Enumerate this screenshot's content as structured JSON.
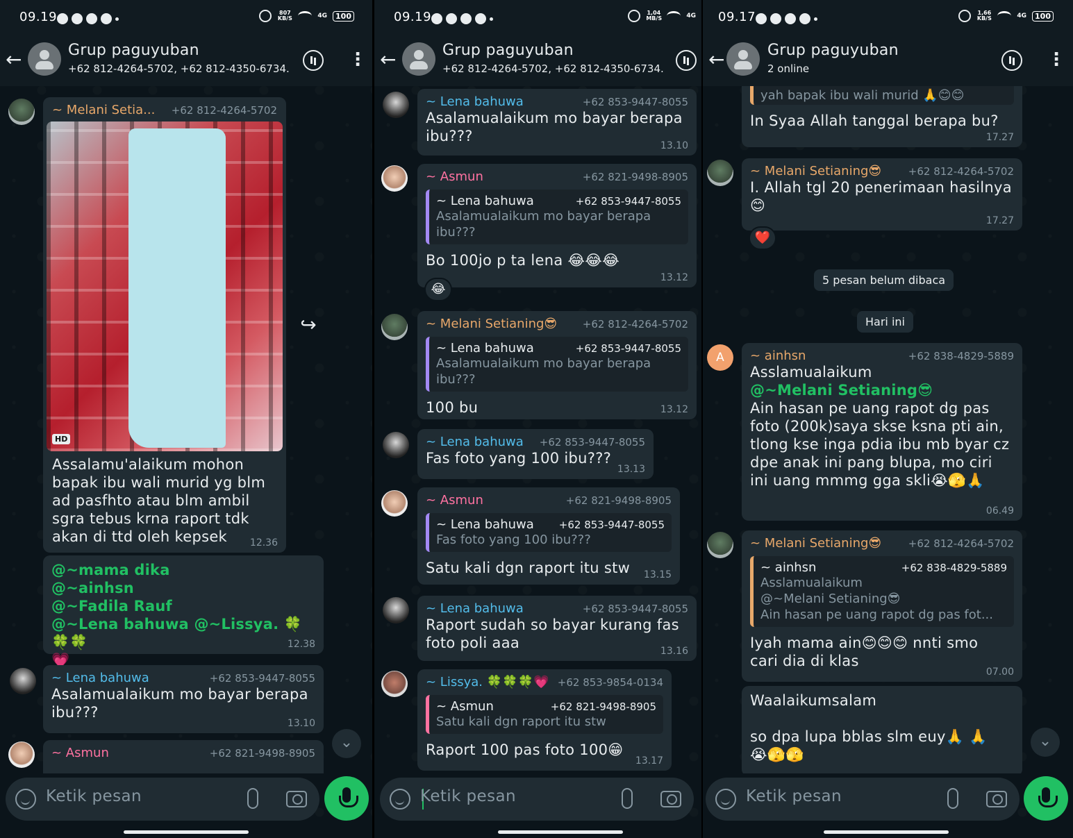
{
  "colors": {
    "background": "#0b141a",
    "bubble": "#202c33",
    "accent_green": "#21c063",
    "name_orange": "#e8a86a",
    "name_blue": "#53bdeb",
    "name_pink": "#ff72a1",
    "quote_purple": "#a389f4"
  },
  "panels": [
    {
      "status": {
        "time": "09.19",
        "net_speed": "807\nKB/S",
        "signal": "4G",
        "battery": "100"
      },
      "header": {
        "title": "Grup paguyuban",
        "subtitle": "+62 812-4264-5702, +62 812-4350-6734..."
      },
      "messages": [
        {
          "sender": "~ Melani Setia...",
          "phone": "+62 812-4264-5702",
          "hd_label": "HD",
          "text": "Assalamu'alaikum mohon\nbapak ibu wali murid yg blm\nad pasfhto atau blm ambil\nsgra tebus krna raport tdk\nakan di ttd oleh kepsek",
          "time": "12.36"
        },
        {
          "mentions": "@~mama dika\n@~ainhsn\n@~Fadila Rauf\n@~Lena bahuwa @~Lissya. 🍀🍀🍀\n💗",
          "time": "12.38"
        },
        {
          "sender": "~ Lena bahuwa",
          "phone": "+62 853-9447-8055",
          "text": "Asalamualaikum mo bayar berapa\nibu???",
          "time": "13.10"
        },
        {
          "sender": "~ Asmun",
          "phone": "+62 821-9498-8905"
        }
      ],
      "composer": {
        "placeholder": "Ketik pesan"
      }
    },
    {
      "status": {
        "time": "09.19",
        "net_speed": "1,04\nMB/S",
        "signal": "4G"
      },
      "header": {
        "title": "Grup paguyuban",
        "subtitle": "+62 812-4264-5702, +62 812-4350-6734..."
      },
      "messages": [
        {
          "sender": "~ Lena bahuwa",
          "phone": "+62 853-9447-8055",
          "text": "Asalamualaikum mo bayar berapa\nibu???",
          "time": "13.10"
        },
        {
          "sender": "~ Asmun",
          "phone": "+62 821-9498-8905",
          "quote_name": "~ Lena bahuwa",
          "quote_phone": "+62 853-9447-8055",
          "quote_text": "Asalamualaikum mo bayar berapa\nibu???",
          "text": "Bo 100jo p ta lena 😂😂😂",
          "time": "13.12",
          "reaction": "😂"
        },
        {
          "sender": "~ Melani Setianing😎",
          "phone": "+62 812-4264-5702",
          "quote_name": "~ Lena bahuwa",
          "quote_phone": "+62 853-9447-8055",
          "quote_text": "Asalamualaikum mo bayar berapa\nibu???",
          "text": "100 bu",
          "time": "13.12"
        },
        {
          "sender": "~ Lena bahuwa",
          "phone": "+62 853-9447-8055",
          "text": "Fas foto yang 100 ibu???",
          "time": "13.13"
        },
        {
          "sender": "~ Asmun",
          "phone": "+62 821-9498-8905",
          "quote_name": "~ Lena bahuwa",
          "quote_phone": "+62 853-9447-8055",
          "quote_text": "Fas foto yang 100 ibu???",
          "text": "Satu kali dgn raport itu stw",
          "time": "13.15"
        },
        {
          "sender": "~ Lena bahuwa",
          "phone": "+62 853-9447-8055",
          "text": "Raport sudah so bayar kurang fas\nfoto poli aaa",
          "time": "13.16"
        },
        {
          "sender": "~ Lissya. 🍀🍀🍀💗",
          "phone": "+62 853-9854-0134",
          "quote_name": "~ Asmun",
          "quote_phone": "+62 821-9498-8905",
          "quote_text": "Satu kali dgn raport itu stw",
          "text": "Raport 100 pas foto 100😁",
          "time": "13.17"
        }
      ],
      "composer": {
        "placeholder": "Ketik pesan"
      }
    },
    {
      "status": {
        "time": "09.17",
        "net_speed": "1,66\nKB/S",
        "signal": "4G",
        "battery": "100"
      },
      "header": {
        "title": "Grup paguyuban",
        "subtitle": "2 online"
      },
      "messages": [
        {
          "quote_text": "yah bapak ibu wali murid 🙏😊😊",
          "text": "In Syaa Allah tanggal berapa bu?",
          "time": "17.27"
        },
        {
          "sender": "~ Melani Setianing😎",
          "phone": "+62 812-4264-5702",
          "text": "I. Allah tgl 20 penerimaan hasilnya\n😊",
          "time": "17.27",
          "reaction": "❤️"
        },
        {
          "sender": "~ ainhsn",
          "phone": "+62 838-4829-5889",
          "avatar_letter": "A",
          "text": "Asslamualaikum",
          "mention": "@~Melani Setianing😎",
          "text2": "Ain hasan pe uang rapot dg pas\nfoto (200k)saya skse ksna pti ain,\ntlong kse inga pdia ibu mb byar cz\ndpe anak ini pang blupa, mo ciri\nini uang mmmg gga skli😭🫣🙏",
          "time": "06.49"
        },
        {
          "sender": "~ Melani Setianing😎",
          "phone": "+62 812-4264-5702",
          "quote_name": "~ ainhsn",
          "quote_phone": "+62 838-4829-5889",
          "quote_text": "Asslamualaikum\n@~Melani Setianing😎\nAin hasan pe uang rapot dg pas fot...",
          "text": "Iyah mama ain😊😊😊 nnti smo\ncari dia di klas",
          "time": "07.00"
        },
        {
          "text": "Waalaikumsalam\n\n so dpa lupa bblas slm euy🙏 🙏\n😭🫣🫣"
        }
      ],
      "unread_label": "5 pesan belum dibaca",
      "today_label": "Hari ini",
      "composer": {
        "placeholder": "Ketik pesan"
      }
    }
  ]
}
